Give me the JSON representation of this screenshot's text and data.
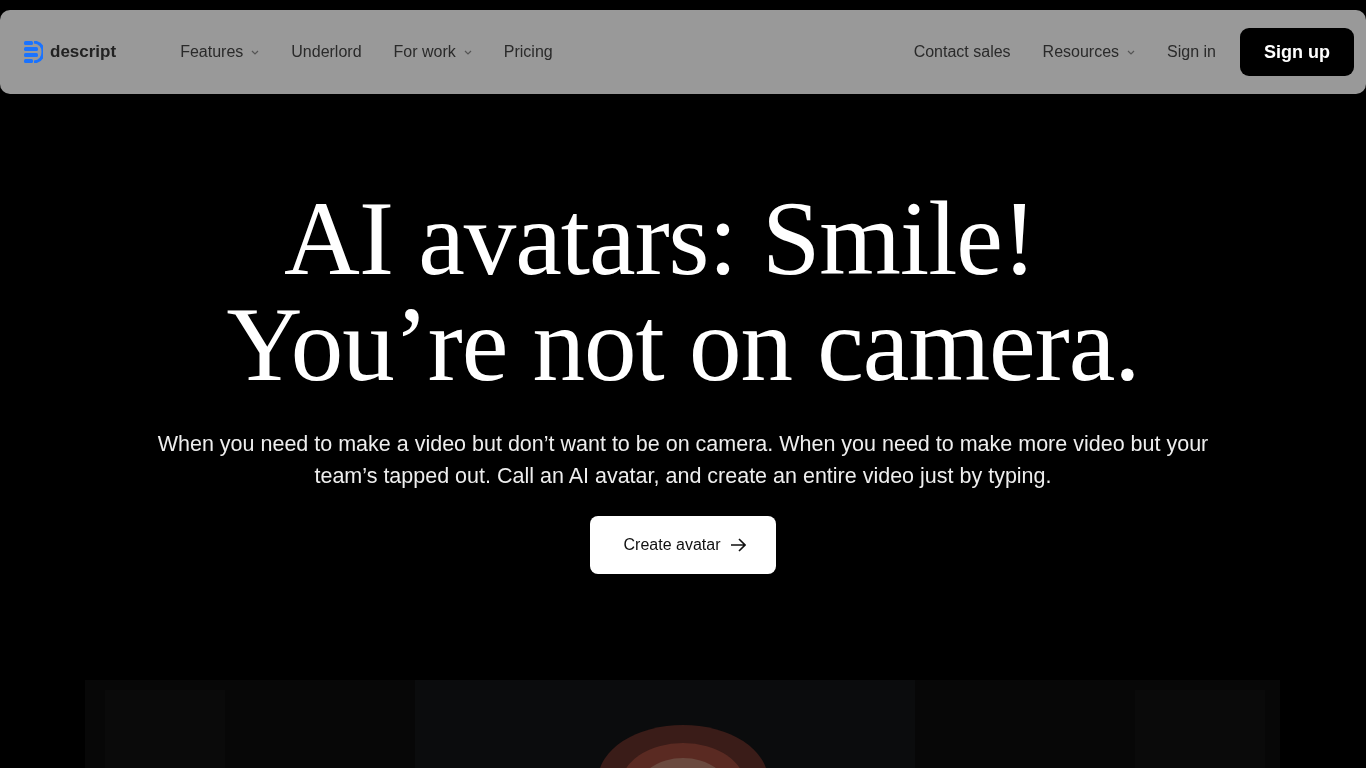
{
  "nav": {
    "logo": "descript",
    "links": [
      {
        "label": "Features",
        "has_menu": true
      },
      {
        "label": "Underlord",
        "has_menu": false
      },
      {
        "label": "For work",
        "has_menu": true
      },
      {
        "label": "Pricing",
        "has_menu": false
      }
    ],
    "right_links": [
      {
        "label": "Contact sales",
        "has_menu": false
      },
      {
        "label": "Resources",
        "has_menu": true
      },
      {
        "label": "Sign in",
        "has_menu": false
      }
    ],
    "signup": "Sign up"
  },
  "hero": {
    "title_lines": [
      "AI avatars: Smile!",
      "You’re not on camera."
    ],
    "description": "When you need to make a video but don’t want to be on camera. When you need to make more video but your team’s tapped out. Call an AI avatar, and create an entire video just by typing.",
    "cta": "Create avatar",
    "media": {
      "kind": "picture"
    }
  }
}
